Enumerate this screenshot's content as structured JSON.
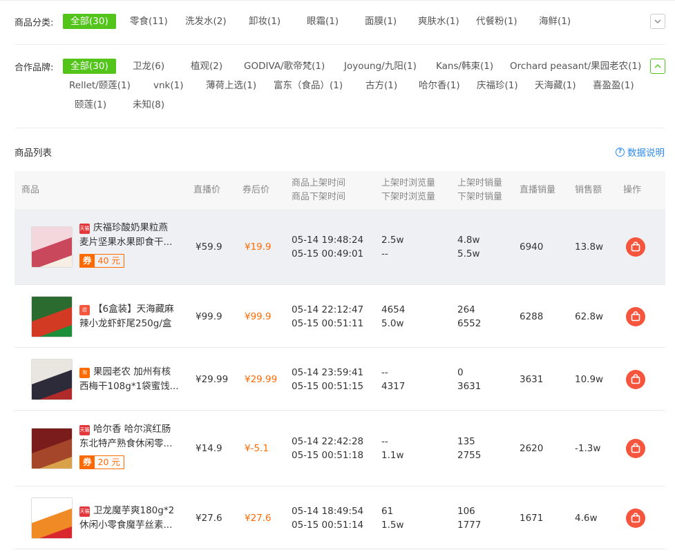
{
  "category_filter": {
    "label": "商品分类:",
    "items": [
      "全部(30)",
      "零食(11)",
      "洗发水(2)",
      "卸妆(1)",
      "眼霜(1)",
      "面膜(1)",
      "爽肤水(1)",
      "代餐粉(1)",
      "海鲜(1)"
    ],
    "toggle_icon": "chevron-down-icon"
  },
  "brand_filter": {
    "label": "合作品牌:",
    "row1": [
      "全部(30)",
      "卫龙(6)",
      "植观(2)",
      "GODIVA/歌帝梵(1)",
      "Joyoung/九阳(1)",
      "Kans/韩束(1)",
      "Orchard peasant/果园老农(1)"
    ],
    "row2": [
      "Rellet/颐莲(1)",
      "vnk(1)",
      "薄荷上选(1)",
      "富东（食品）(1)",
      "古方(1)",
      "哈尔香(1)",
      "庆福珍(1)",
      "天海藏(1)",
      "喜盈盈(1)"
    ],
    "row3": [
      "颐莲(1)",
      "未知(8)"
    ],
    "toggle_icon": "chevron-up-icon"
  },
  "list": {
    "title": "商品列表",
    "help_label": "数据说明"
  },
  "table": {
    "headers": {
      "product": "商品",
      "live_price": "直播价",
      "coupon_price": "券后价",
      "time_on": "商品上架时间",
      "time_off": "商品下架时间",
      "views_on": "上架时浏览量",
      "views_off": "下架时浏览量",
      "sales_on": "上架时销量",
      "sales_off": "下架时销量",
      "live_sales": "直播销量",
      "revenue": "销售额",
      "action": "操作"
    },
    "rows": [
      {
        "shop": "tmall",
        "shop_badge": "天猫",
        "shop_color": "#e4393c",
        "name_line1": "庆福珍酸奶果粒燕",
        "name_line2": "麦片坚果水果即食干...",
        "coupon_tag": "券",
        "coupon_amount": "40 元",
        "live_price": "¥59.9",
        "coupon_price": "¥19.9",
        "time_on": "05-14 19:48:24",
        "time_off": "05-15 00:49:01",
        "views_on": "2.5w",
        "views_off": "--",
        "sales_on": "4.8w",
        "sales_off": "5.5w",
        "live_sales": "6940",
        "revenue": "13.8w",
        "thumb_colors": [
          "#f4d7dc",
          "#c9485b",
          "#f7efe4"
        ]
      },
      {
        "shop": "taobao-shop",
        "shop_badge": "店",
        "shop_color": "#f5553d",
        "name_line1": "【6盒装】天海藏麻",
        "name_line2": "辣小龙虾虾尾250g/盒",
        "live_price": "¥99.9",
        "coupon_price": "¥99.9",
        "time_on": "05-14 22:12:47",
        "time_off": "05-15 00:51:11",
        "views_on": "4654",
        "views_off": "5.0w",
        "sales_on": "264",
        "sales_off": "6552",
        "live_sales": "6288",
        "revenue": "62.8w",
        "thumb_colors": [
          "#2c6b2f",
          "#d23a23",
          "#1d8f3a"
        ]
      },
      {
        "shop": "taobao",
        "shop_badge": "淘",
        "shop_color": "#ff6a00",
        "name_line1": "果园老农 加州有核",
        "name_line2": "西梅干108g*1袋蜜饯...",
        "live_price": "¥29.99",
        "coupon_price": "¥29.99",
        "time_on": "05-14 23:59:41",
        "time_off": "05-15 00:51:15",
        "views_on": "--",
        "views_off": "4317",
        "sales_on": "0",
        "sales_off": "3631",
        "live_sales": "3631",
        "revenue": "10.9w",
        "thumb_colors": [
          "#e9e6e1",
          "#2d2a3a",
          "#b12a2a"
        ]
      },
      {
        "shop": "tmall",
        "shop_badge": "天猫",
        "shop_color": "#e4393c",
        "name_line1": "哈尔香 哈尔滨红肠",
        "name_line2": "东北特产熟食休闲零...",
        "coupon_tag": "券",
        "coupon_amount": "20 元",
        "live_price": "¥14.9",
        "coupon_price": "¥-5.1",
        "time_on": "05-14 22:42:28",
        "time_off": "05-15 00:51:18",
        "views_on": "--",
        "views_off": "1.1w",
        "sales_on": "135",
        "sales_off": "2755",
        "live_sales": "2620",
        "revenue": "-1.3w",
        "thumb_colors": [
          "#7a1c1c",
          "#a5462a",
          "#d9a14a"
        ]
      },
      {
        "shop": "tmall",
        "shop_badge": "天猫",
        "shop_color": "#e4393c",
        "name_line1": "卫龙魔芋爽180g*2",
        "name_line2": "休闲小零食魔芋丝素...",
        "live_price": "¥27.6",
        "coupon_price": "¥27.6",
        "time_on": "05-14 18:49:54",
        "time_off": "05-15 00:51:14",
        "views_on": "61",
        "views_off": "1.5w",
        "sales_on": "106",
        "sales_off": "1777",
        "live_sales": "1671",
        "revenue": "4.6w",
        "thumb_colors": [
          "#ffffff",
          "#f08a24",
          "#d8282e"
        ]
      }
    ],
    "action_icon": "shopping-bag-icon"
  },
  "colors": {
    "accent_green": "#52c41a",
    "price_orange": "#ff6a00",
    "link_blue": "#2d8cf0",
    "action_red": "#f5553d"
  }
}
